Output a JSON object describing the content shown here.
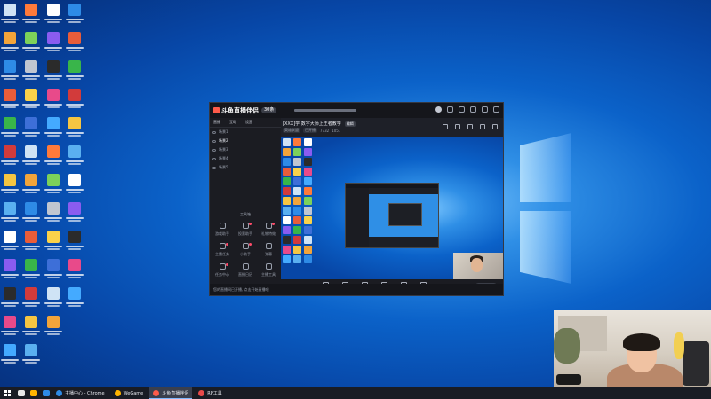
{
  "desktop": {
    "icon_colors": [
      "#cfe3f5",
      "#f2a43a",
      "#2e8be6",
      "#e85d3a",
      "#39b54a",
      "#d23b3b",
      "#f5c542",
      "#5ab0f0",
      "#ffffff",
      "#8a5cf0",
      "#2b2b2b",
      "#e84a8a",
      "#44aaff",
      "#ff7a3a",
      "#7cd15a",
      "#c0c6d0",
      "#fad24a",
      "#3d6fd8"
    ]
  },
  "app": {
    "logo": "斗鱼直播伴侣",
    "badge": "30条",
    "left_tabs": [
      "直播",
      "互动",
      "设置"
    ],
    "scenes": [
      "场景1",
      "场景2",
      "场景3",
      "场景4",
      "场景5"
    ],
    "tools_title": "工具箱",
    "tools": [
      {
        "label": "游戏助手",
        "icon": "gamepad-icon",
        "alert": false
      },
      {
        "label": "投票助手",
        "icon": "vote-icon",
        "alert": true
      },
      {
        "label": "礼物特效",
        "icon": "gift-icon",
        "alert": true
      },
      {
        "label": "主播任务",
        "icon": "task-icon",
        "alert": true
      },
      {
        "label": "小助手",
        "icon": "assistant-icon",
        "alert": true
      },
      {
        "label": "弹幕",
        "icon": "danmaku-icon",
        "alert": false
      },
      {
        "label": "任务中心",
        "icon": "calendar-icon",
        "alert": true
      },
      {
        "label": "直播日历",
        "icon": "clock-icon",
        "alert": false
      },
      {
        "label": "主播工具",
        "icon": "tools-icon",
        "alert": false
      }
    ],
    "room": {
      "title": "[XXX]学 数字大师上王者教学",
      "edit_label": "编辑",
      "category": "英雄联盟",
      "status": "已开播",
      "viewers": "7732",
      "fans": "1057"
    },
    "toolbar": [
      {
        "label": "直播素材",
        "icon": "material-icon"
      },
      {
        "label": "摄像头",
        "icon": "camera-icon"
      },
      {
        "label": "桌面窗口",
        "icon": "monitor-icon"
      },
      {
        "label": "游戏窗口",
        "icon": "window-icon"
      },
      {
        "label": "麦克风",
        "icon": "mic-icon"
      },
      {
        "label": "扬声器",
        "icon": "speaker-icon"
      }
    ],
    "start_button": "开始直播",
    "bottom_message": "您的直播间已开播, 点击开始直播吧"
  },
  "taskbar": {
    "tasks": [
      {
        "label": "主播中心 - Chrome",
        "color": "#2e8be6",
        "active": false
      },
      {
        "label": "WeGame",
        "color": "#ffb400",
        "active": false
      },
      {
        "label": "斗鱼直播伴侣",
        "color": "#ff5b4a",
        "active": true
      },
      {
        "label": "RP工具",
        "color": "#e84a4a",
        "active": false
      }
    ],
    "pinned_colors": [
      "#e8e8e8",
      "#ffb400",
      "#2e8be6"
    ]
  }
}
